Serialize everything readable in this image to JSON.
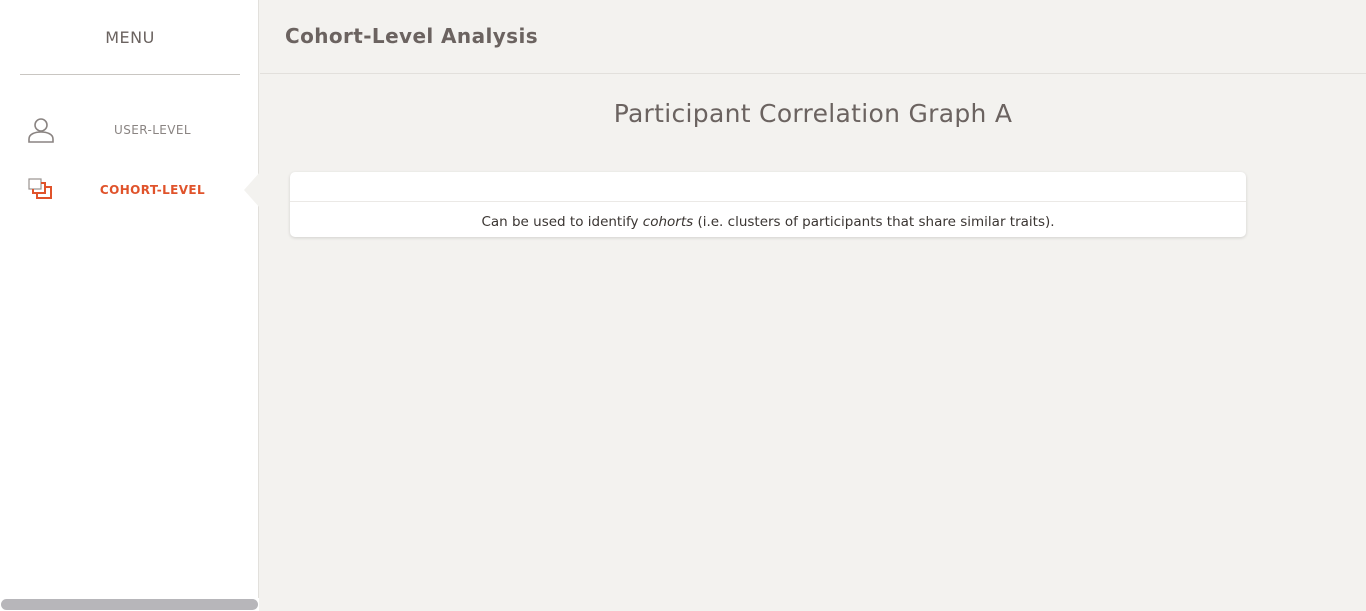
{
  "sidebar": {
    "menu_title": "MENU",
    "items": [
      {
        "label": "USER-LEVEL",
        "icon": "user-icon"
      },
      {
        "label": "COHORT-LEVEL",
        "icon": "cohort-icon",
        "active": true
      }
    ]
  },
  "header": {
    "title": "Cohort-Level Analysis"
  },
  "main": {
    "graph_title": "Participant Correlation Graph A",
    "card": {
      "text_before": "Can be used to identify ",
      "text_emphasis": "cohorts",
      "text_after": " (i.e. clusters of participants that share similar traits)."
    }
  },
  "colors": {
    "accent": "#e0532b",
    "text_muted": "#8a8482",
    "heading": "#6b6360",
    "background": "#f3f2ef"
  }
}
